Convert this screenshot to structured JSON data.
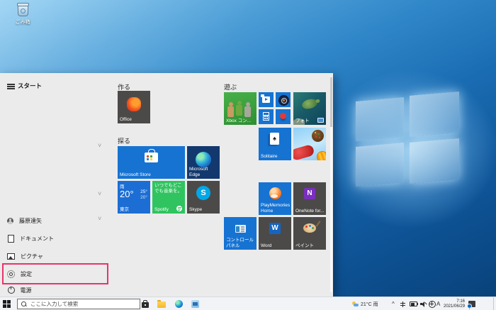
{
  "colors": {
    "accent_blue": "#1673d2",
    "highlight_pink": "#e9336b",
    "spotify_green": "#2fc45f",
    "xbox_green": "#3ba33b",
    "menu_gray": "#ebebeb"
  },
  "icons": {
    "spade": "♠",
    "group_chevron": "˅",
    "tray_chevron": "^",
    "skype_logo": "S",
    "word_logo": "W",
    "onenote_logo": "N"
  },
  "desktop": {
    "recycle_bin_label": "ごみ箱"
  },
  "start_menu": {
    "title": "スタート",
    "nav": {
      "user": "藤原達矢",
      "documents": "ドキュメント",
      "pictures": "ピクチャ",
      "settings": "設定",
      "power": "電源"
    },
    "groups": {
      "create": "作る",
      "explore": "探る",
      "play": "遊ぶ"
    },
    "tiles": {
      "office": {
        "label": "Office"
      },
      "store": {
        "label": "Microsoft Store"
      },
      "edge": {
        "label": "Microsoft Edge"
      },
      "weather": {
        "condition": "雨",
        "temp": "20°",
        "high": "25°",
        "low": "20°",
        "city": "東京"
      },
      "spotify": {
        "tagline": "いつでもどこでも音楽を。",
        "label": "Spotify"
      },
      "skype": {
        "label": "Skype"
      },
      "xbox": {
        "label": "Xbox コン..."
      },
      "photos": {
        "label": "フォト"
      },
      "solitaire": {
        "label": "Solitaire"
      },
      "playmemories": {
        "label": "PlayMemories Home"
      },
      "onenote": {
        "label": "OneNote for..."
      },
      "control_panel": {
        "label": "コントロール パネル"
      },
      "word": {
        "label": "Word"
      },
      "paint": {
        "label": "ペイント"
      }
    }
  },
  "taskbar": {
    "search_placeholder": "ここに入力して検索",
    "tray": {
      "weather": "21°C 雨",
      "ime": "A",
      "time": "7:16",
      "date": "2021/06/29"
    }
  }
}
